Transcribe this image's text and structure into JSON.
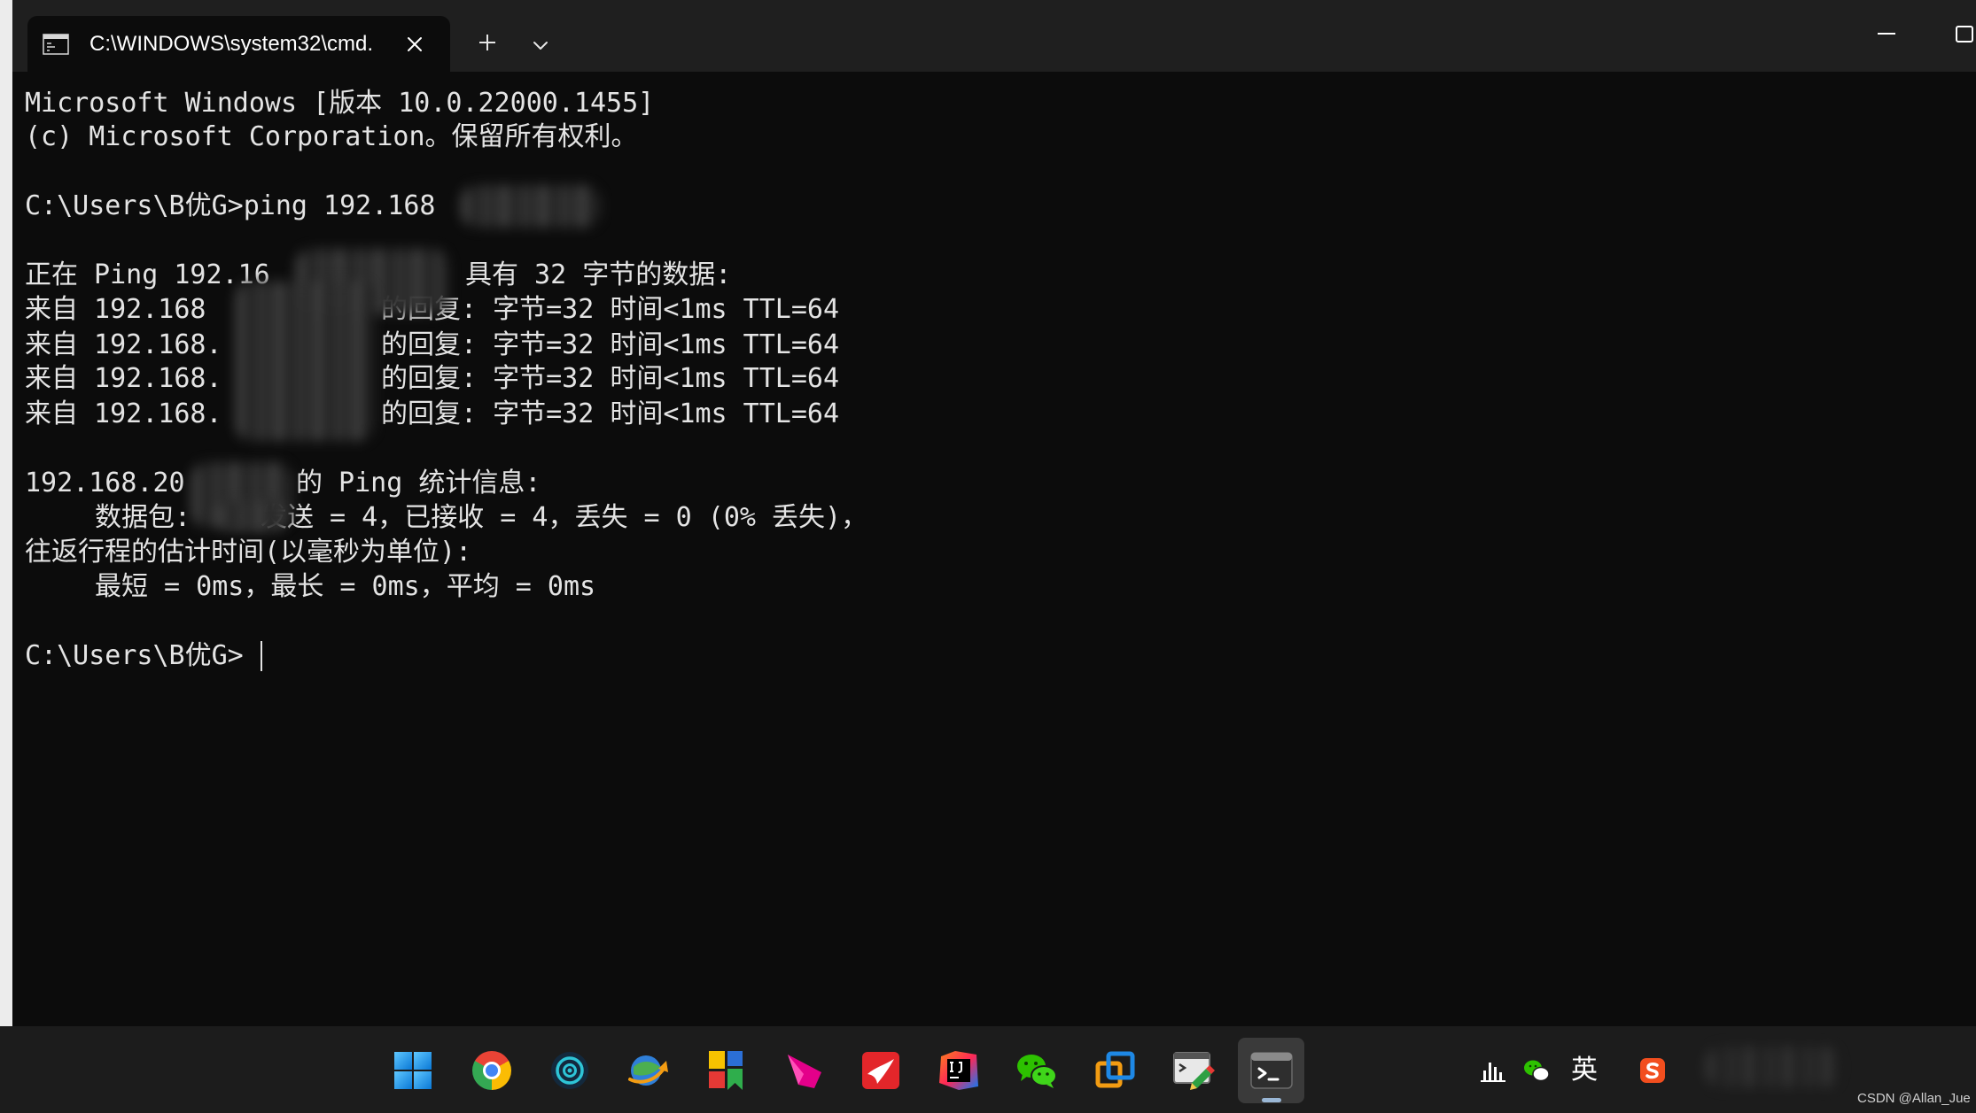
{
  "window": {
    "tab_title": "C:\\WINDOWS\\system32\\cmd.",
    "icons": {
      "tab": "cmd-icon",
      "close_tab": "close-icon",
      "new_tab": "plus-icon",
      "tab_dropdown": "chevron-down-icon",
      "minimize": "minimize-icon",
      "maximize": "maximize-icon"
    }
  },
  "terminal": {
    "banner_version": "Microsoft Windows [版本 10.0.22000.1455]",
    "banner_copyright": "(c) Microsoft Corporation。保留所有权利。",
    "ping_command": "C:\\Users\\B优G>ping 192.168",
    "pinging": {
      "prefix": "正在 Ping 192.16",
      "suffix": "具有 32 字节的数据:"
    },
    "replies": [
      {
        "prefix": "来自 192.168",
        "suffix": "的回复: 字节=32 时间<1ms TTL=64"
      },
      {
        "prefix": "来自 192.168.",
        "suffix": "的回复: 字节=32 时间<1ms TTL=64"
      },
      {
        "prefix": "来自 192.168.",
        "suffix": "的回复: 字节=32 时间<1ms TTL=64"
      },
      {
        "prefix": "来自 192.168.",
        "suffix": "的回复: 字节=32 时间<1ms TTL=64"
      }
    ],
    "statistics": {
      "prefix": "192.168.20",
      "suffix": "的 Ping 统计信息:"
    },
    "packets": {
      "prefix": "数据包:",
      "suffix": "发送 = 4，已接收 = 4，丢失 = 0 (0% 丢失)，"
    },
    "rtt_header": "往返行程的估计时间(以毫秒为单位):",
    "rtt_values": "最短 = 0ms，最长 = 0ms，平均 = 0ms",
    "current_prompt": "C:\\Users\\B优G>"
  },
  "taskbar": {
    "pinned_apps": [
      "windows-start-icon",
      "chrome-icon",
      "target-app-icon",
      "download-manager-icon",
      "color-blocks-app-icon",
      "pink-shape-app-icon",
      "red-swoosh-app-icon",
      "intellij-idea-icon",
      "wechat-icon",
      "virtual-machine-icon",
      "ssh-terminal-icon",
      "windows-terminal-icon"
    ],
    "active_app": "windows-terminal-icon",
    "tray": {
      "icons": [
        "bar-chart-icon",
        "wechat-tray-icon",
        "sogou-input-icon"
      ],
      "input_mode": "英"
    }
  },
  "watermark": "CSDN @Allan_Jue",
  "colors": {
    "terminal_bg": "#0c0c0c",
    "terminal_text": "#e4e4e4",
    "titlebar_bg": "#1f1f1f",
    "taskbar_bg": "#1c1c1c",
    "active_app_bg": "#3a3a3a"
  }
}
